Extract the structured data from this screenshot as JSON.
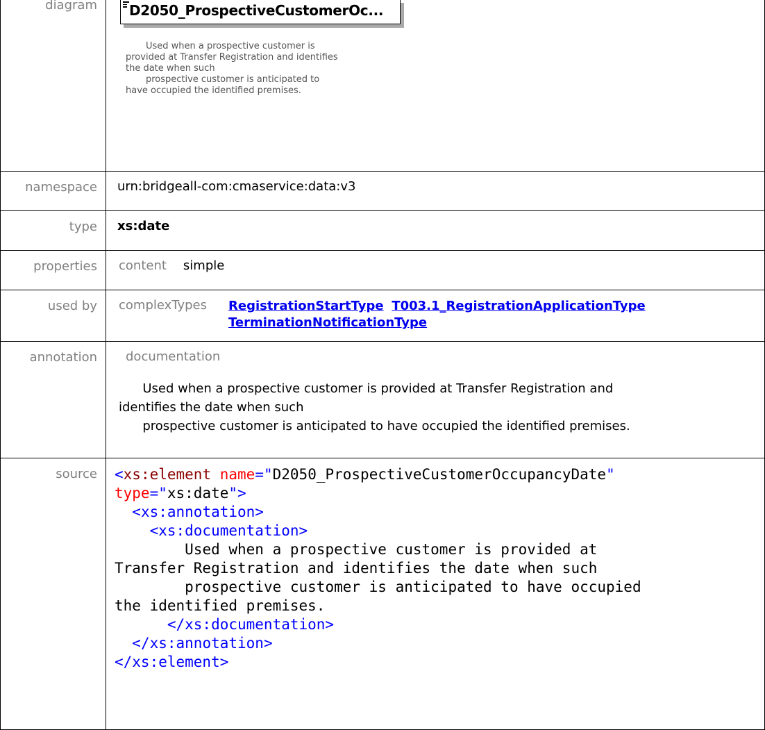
{
  "labels": {
    "diagram": "diagram",
    "namespace": "namespace",
    "type": "type",
    "properties": "properties",
    "used_by": "used by",
    "annotation": "annotation",
    "source": "source"
  },
  "diagram": {
    "element_name": "D2050_ProspectiveCustomerOc...",
    "note": "       Used when a prospective customer is\nprovided at Transfer Registration and identifies\nthe date when such\n       prospective customer is anticipated to\nhave occupied the identified premises."
  },
  "namespace": "urn:bridgeall-com:cmaservice:data:v3",
  "type": "xs:date",
  "properties": {
    "key": "content",
    "value": "simple"
  },
  "used_by": {
    "key": "complexTypes",
    "links": [
      "RegistrationStartType",
      "T003.1_RegistrationApplicationType",
      "TerminationNotificationType"
    ]
  },
  "annotation": {
    "key": "documentation",
    "text": "      Used when a prospective customer is provided at Transfer Registration and\nidentifies the date when such\n      prospective customer is anticipated to have occupied the identified premises."
  },
  "source": {
    "l1_open": "<",
    "l1_tag": "xs:element",
    "l1_attr1": "name",
    "l1_eq1": "=\"",
    "l1_val1": "D2050_ProspectiveCustomerOccupancyDate",
    "l1_q1": "\"",
    "l2_attr2": "type",
    "l2_eq2": "=\"",
    "l2_val2": "xs:date",
    "l2_close": "\">",
    "l3": "  <xs:annotation>",
    "l4": "    <xs:documentation>",
    "doc_text": "        Used when a prospective customer is provided at\nTransfer Registration and identifies the date when such\n        prospective customer is anticipated to have occupied\nthe identified premises.",
    "l5": "      </xs:documentation>",
    "l6": "  </xs:annotation>",
    "l7": "</xs:element>"
  }
}
